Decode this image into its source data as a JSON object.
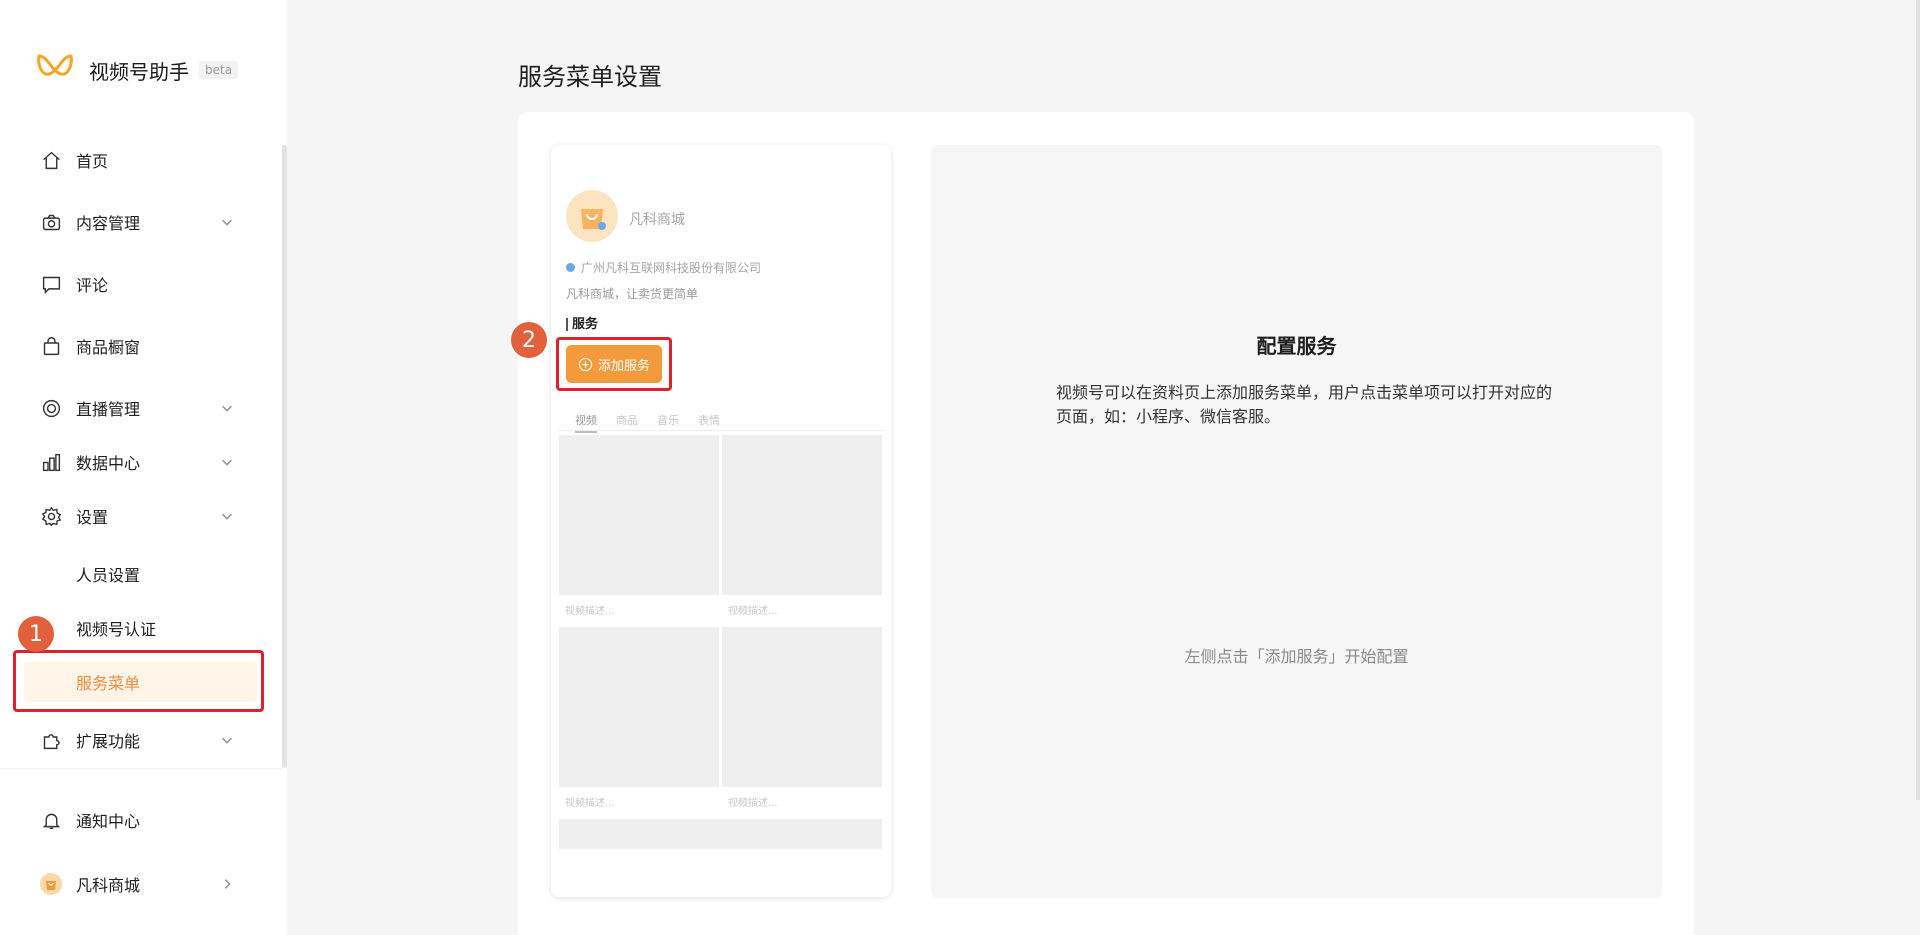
{
  "app": {
    "name": "视频号助手",
    "badge": "beta"
  },
  "sidebar": {
    "items": [
      {
        "label": "首页",
        "icon": "home-icon"
      },
      {
        "label": "内容管理",
        "icon": "camera-icon",
        "expandable": true
      },
      {
        "label": "评论",
        "icon": "comment-icon"
      },
      {
        "label": "商品橱窗",
        "icon": "shopping-bag-icon"
      },
      {
        "label": "直播管理",
        "icon": "live-icon",
        "expandable": true
      },
      {
        "label": "数据中心",
        "icon": "bar-chart-icon",
        "expandable": true
      },
      {
        "label": "设置",
        "icon": "gear-icon",
        "expandable": true
      }
    ],
    "settings_sub": [
      {
        "label": "人员设置"
      },
      {
        "label": "视频号认证"
      },
      {
        "label": "服务菜单",
        "active": true
      }
    ],
    "extension": {
      "label": "扩展功能",
      "icon": "puzzle-icon"
    },
    "notice": {
      "label": "通知中心",
      "icon": "bell-icon"
    },
    "account": {
      "label": "凡科商城"
    }
  },
  "annotations": {
    "step1": "1",
    "step2": "2",
    "highlight_color": "#e0202c",
    "badge_color": "#e2603c"
  },
  "main": {
    "title": "服务菜单设置",
    "preview": {
      "name": "凡科商城",
      "company": "广州凡科互联网科技股份有限公司",
      "desc": "凡科商城，让卖货更简单",
      "service_heading": "服务",
      "add_button": "添加服务",
      "tabs": [
        "视频",
        "商品",
        "音乐",
        "表情"
      ],
      "tile_caption": "视频描述..."
    },
    "config": {
      "title": "配置服务",
      "desc": "视频号可以在资料页上添加服务菜单，用户点击菜单项可以打开对应的页面，如：小程序、微信客服。",
      "hint": "左侧点击「添加服务」开始配置"
    }
  },
  "colors": {
    "accent": "#f39b3c",
    "active_bg": "#fff4e8",
    "active_text": "#f08c3a"
  }
}
